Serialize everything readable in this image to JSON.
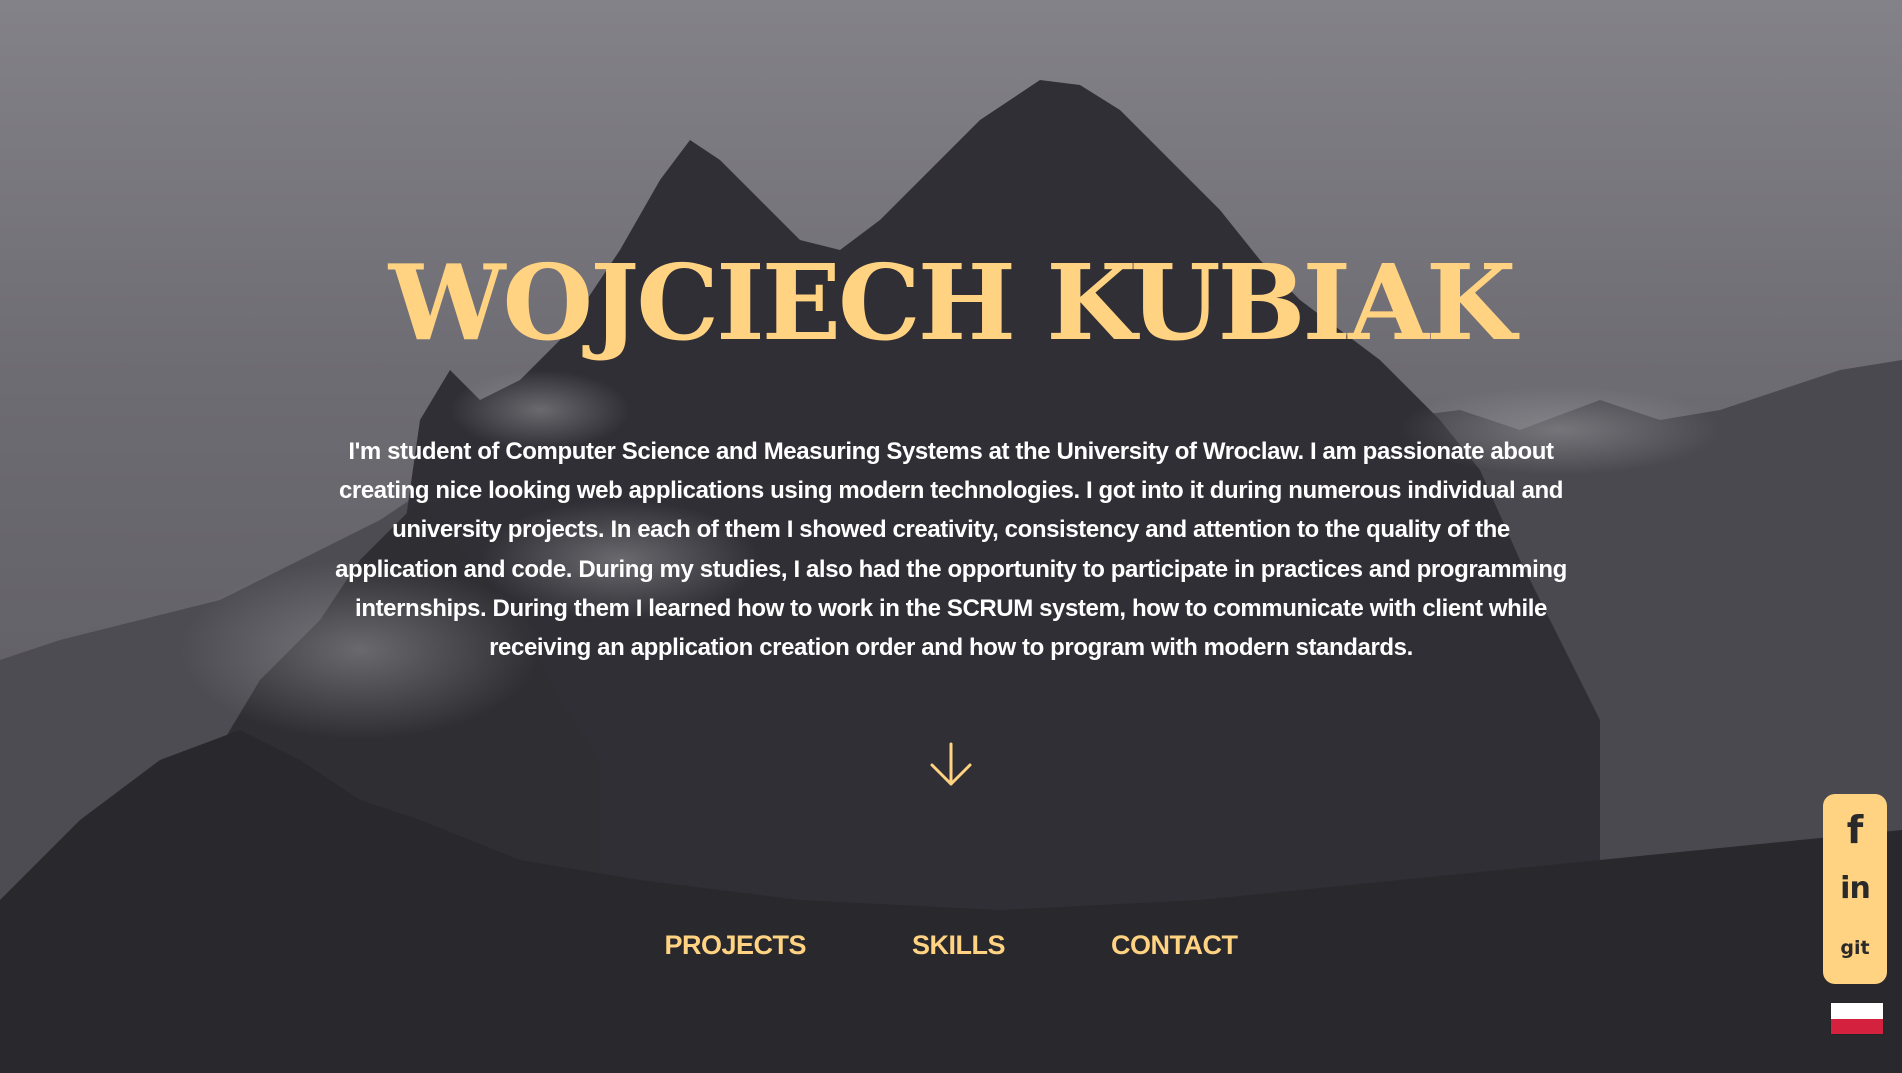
{
  "hero": {
    "name": "WOJCIECH KUBIAK",
    "bio": "I'm student of Computer Science and Measuring Systems at the University of Wroclaw. I am passionate about creating nice looking web applications using modern technologies. I got into it during numerous individual and university projects. In each of them I showed creativity, consistency and attention to the quality of the application and code. During my studies, I also had the opportunity to participate in practices and programming internships. During them I learned how to work in the SCRUM system, how to communicate with client while receiving an application creation order and how to program with modern standards.",
    "scroll_icon": "arrow-down-icon"
  },
  "nav": {
    "items": [
      {
        "label": "PROJECTS"
      },
      {
        "label": "SKILLS"
      },
      {
        "label": "CONTACT"
      }
    ]
  },
  "social": {
    "facebook": {
      "label": "f",
      "icon": "facebook-icon"
    },
    "linkedin": {
      "label": "in",
      "icon": "linkedin-icon"
    },
    "git": {
      "label": "git",
      "icon": "git-icon"
    }
  },
  "language": {
    "icon": "poland-flag-icon"
  },
  "colors": {
    "accent": "#ffd382",
    "text": "#ffffff",
    "background": "#2b2a2f",
    "flag_red": "#d4213d"
  }
}
